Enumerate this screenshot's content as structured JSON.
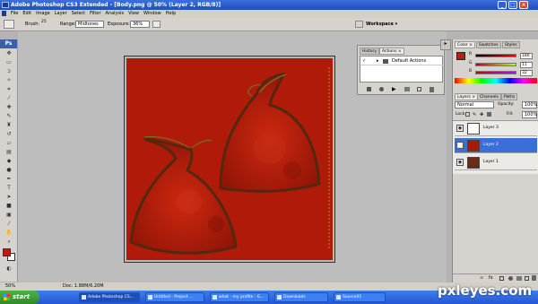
{
  "window": {
    "title": "Adobe Photoshop CS3 Extended - [Body.png @ 50% (Layer 2, RGB/8)]",
    "controls": [
      "_",
      "□",
      "×"
    ]
  },
  "menu": [
    "File",
    "Edit",
    "Image",
    "Layer",
    "Select",
    "Filter",
    "Analysis",
    "View",
    "Window",
    "Help"
  ],
  "options": {
    "brush_label": "Brush:",
    "brush_size": "25",
    "range_label": "Range:",
    "range_value": "Midtones",
    "exposure_label": "Exposure:",
    "exposure_value": "36%",
    "workspace": "Workspace ▾"
  },
  "tools_header": "Ps",
  "actions_panel": {
    "tabs": [
      "History",
      "Actions ×"
    ],
    "item": "Default Actions"
  },
  "color_panel": {
    "tabs": [
      "Color ×",
      "Swatches",
      "Styles"
    ],
    "labels": [
      "R",
      "G",
      "B"
    ],
    "values": [
      "180",
      "11",
      "32"
    ]
  },
  "layers_panel": {
    "tabs": [
      "Layers ×",
      "Channels",
      "Paths"
    ],
    "blend_mode": "Normal",
    "opacity_label": "Opacity:",
    "opacity": "100%",
    "lock_label": "Lock:",
    "fill_label": "Fill:",
    "fill": "100%",
    "layers": [
      {
        "name": "Layer 3",
        "selected": false,
        "thumb": "#ffffff"
      },
      {
        "name": "Layer 2",
        "selected": true,
        "thumb": "#a81a08"
      },
      {
        "name": "Layer 1",
        "selected": false,
        "thumb": "#6a2a1a"
      }
    ]
  },
  "status": {
    "zoom": "50%",
    "doc": "Doc: 1.88M/6.20M"
  },
  "taskbar": {
    "start": "start",
    "tasks": [
      "Adobe Photoshop CS...",
      "Untitled - Project ...",
      "what - my profile - G...",
      "Downloads",
      "Source01"
    ]
  },
  "watermark": "pxleyes.com",
  "colors": {
    "canvas": "#b01a08",
    "fg_swatch": "#b4200b",
    "selection": "#3a6fd8"
  }
}
